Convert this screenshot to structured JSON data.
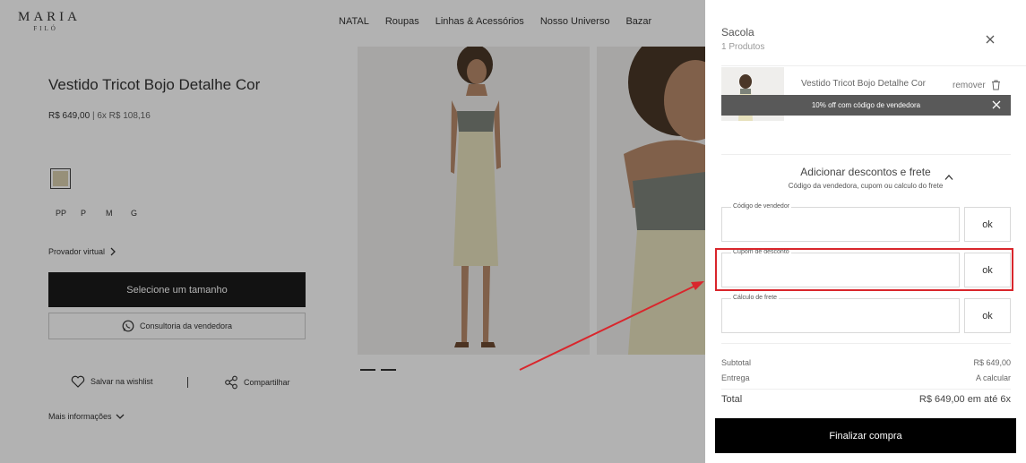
{
  "brand": {
    "line1": "MARIA",
    "line2": "FILÓ"
  },
  "nav": [
    {
      "label": "NATAL"
    },
    {
      "label": "Roupas"
    },
    {
      "label": "Linhas & Acessórios"
    },
    {
      "label": "Nosso Universo"
    },
    {
      "label": "Bazar"
    }
  ],
  "product": {
    "title": "Vestido Tricot Bojo Detalhe Cor",
    "price": "R$ 649,00",
    "installments": "| 6x R$ 108,16",
    "sizes": [
      "PP",
      "P",
      "M",
      "G"
    ],
    "virtual_fitting": "Provador virtual",
    "select_size": "Selecione um tamanho",
    "consult": "Consultoria da vendedora",
    "wishlist": "Salvar na wishlist",
    "share": "Compartilhar",
    "more_info": "Mais informações"
  },
  "cart": {
    "title": "Sacola",
    "count": "1 Produtos",
    "item_name": "Vestido Tricot Bojo Detalhe Cor",
    "remove": "remover",
    "toast": "10% off com código de vendedora",
    "discounts_title": "Adicionar descontos e frete",
    "discounts_subtitle": "Código da vendedora, cupom ou calculo do frete",
    "fields": {
      "seller_code": {
        "label": "Código de vendedor",
        "ok": "ok"
      },
      "coupon": {
        "label": "Cupom de desconto",
        "ok": "ok"
      },
      "shipping": {
        "label": "Cálculo de frete",
        "ok": "ok"
      }
    },
    "subtotal_label": "Subtotal",
    "subtotal_value": "R$ 649,00",
    "delivery_label": "Entrega",
    "delivery_value": "A calcular",
    "total_label": "Total",
    "total_value": "R$ 649,00 em até 6x",
    "checkout": "Finalizar compra"
  },
  "colors": {
    "accent_red": "#d9262c",
    "dark_button": "#1a1a1a",
    "swatch": "#d9cfae",
    "toast_bg": "#595959"
  }
}
